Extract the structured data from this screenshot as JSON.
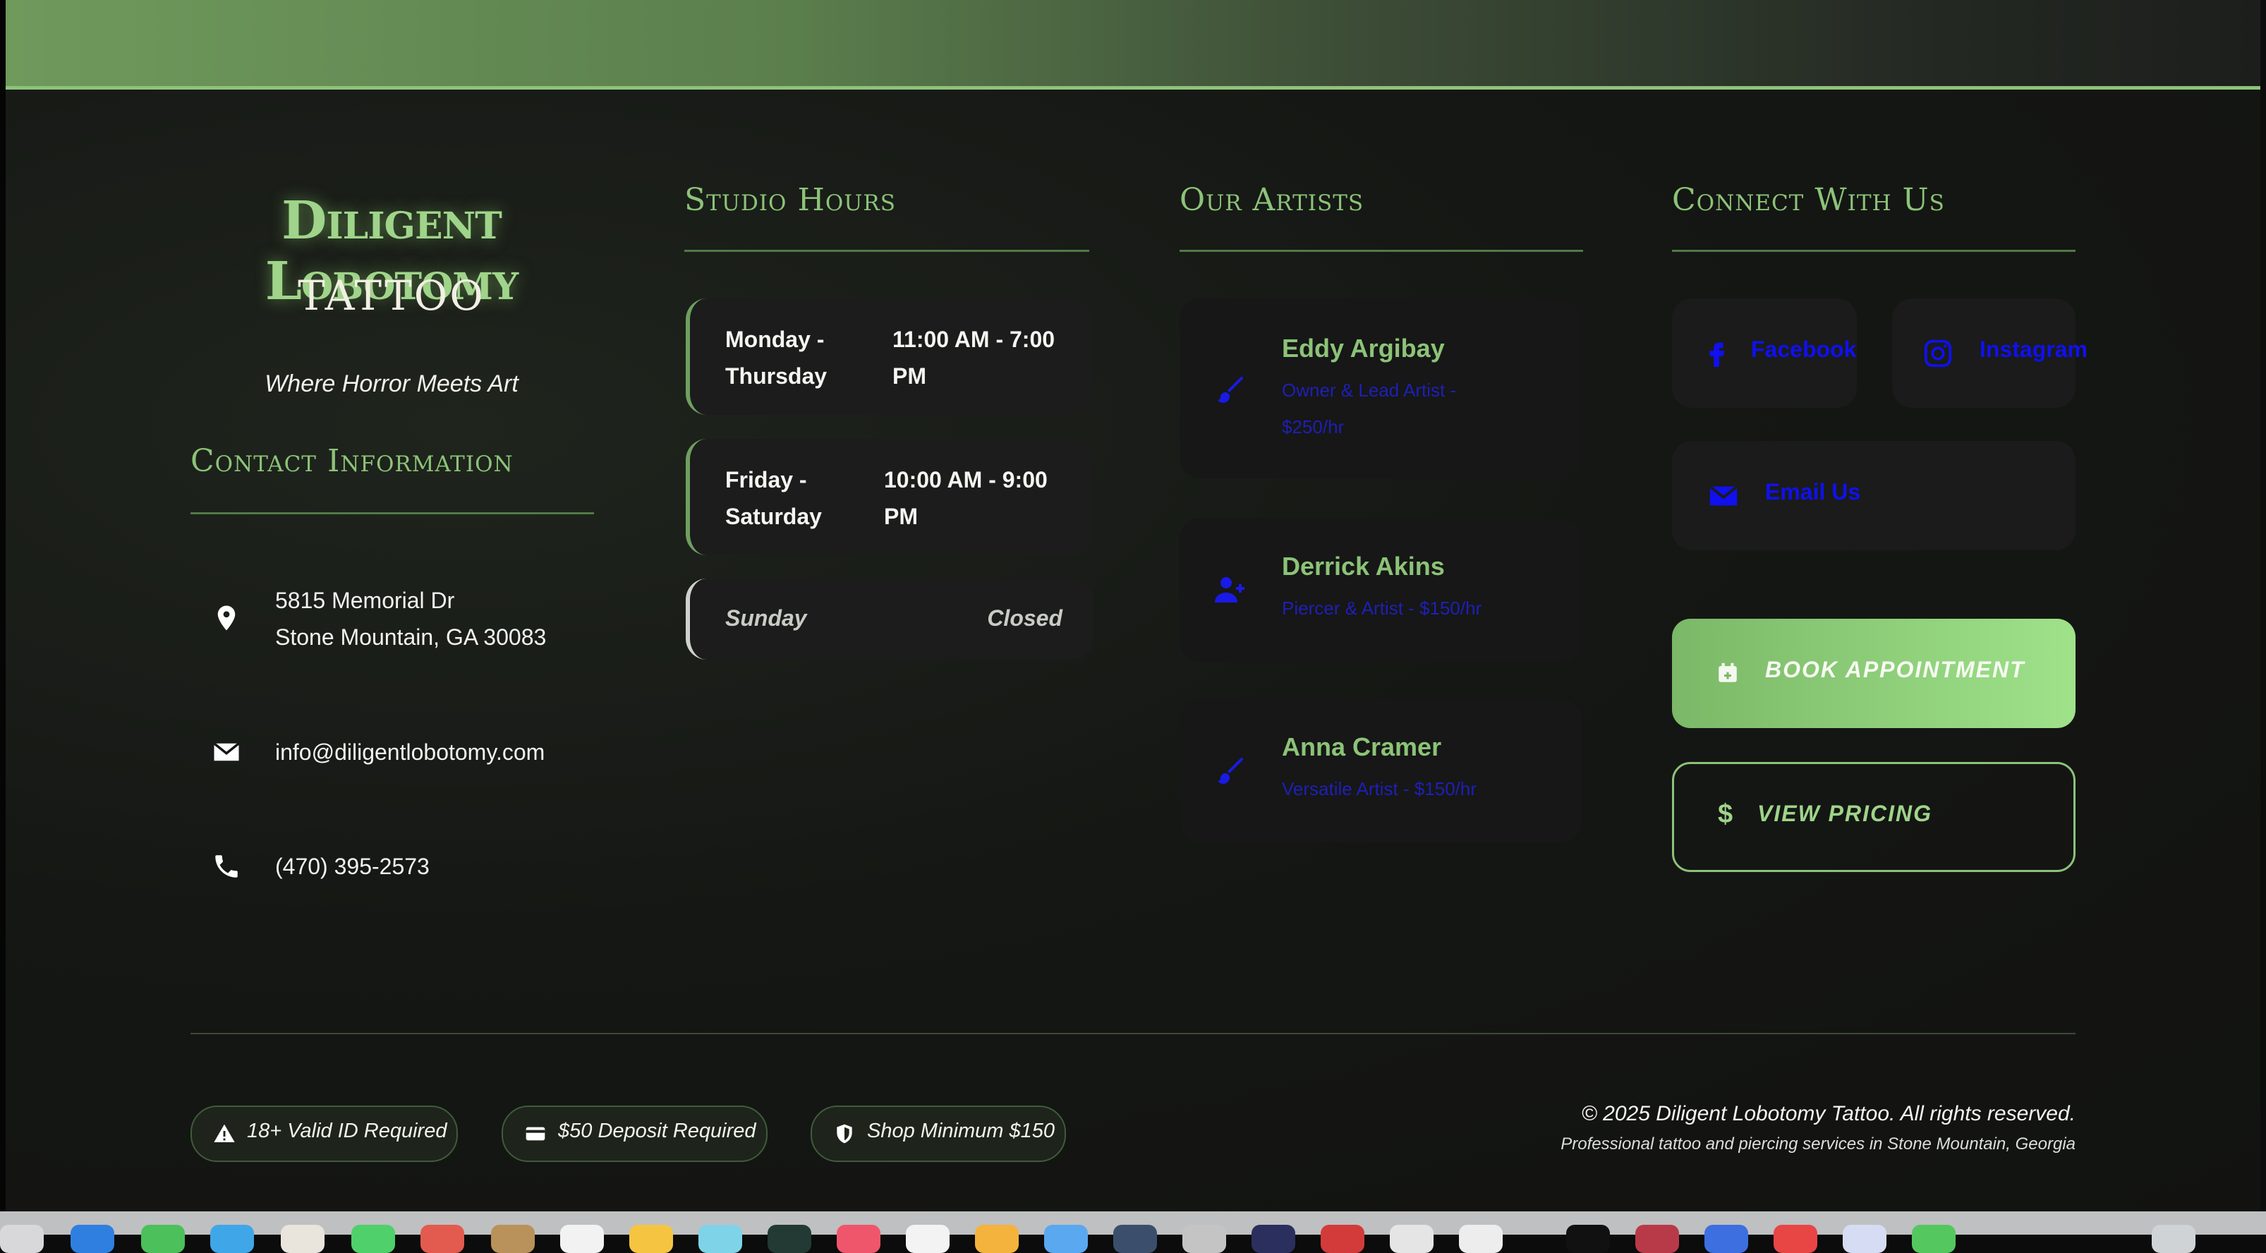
{
  "brand": {
    "title": "Diligent Lobotomy",
    "subtitle": "TATTOO",
    "tagline": "Where Horror Meets Art"
  },
  "contact": {
    "heading": "Contact Information",
    "address_line1": "5815 Memorial Dr",
    "address_line2": "Stone Mountain, GA 30083",
    "email": "info@diligentlobotomy.com",
    "phone": "(470) 395-2573"
  },
  "hours": {
    "heading": "Studio Hours",
    "rows": [
      {
        "day1": "Monday -",
        "day2": "Thursday",
        "time1": "11:00 AM - 7:00",
        "time2": "PM"
      },
      {
        "day1": "Friday -",
        "day2": "Saturday",
        "time1": "10:00 AM - 9:00",
        "time2": "PM"
      },
      {
        "day1": "Sunday",
        "time1": "Closed"
      }
    ]
  },
  "artists": {
    "heading": "Our Artists",
    "items": [
      {
        "name": "Eddy Argibay",
        "role": "Owner & Lead Artist - $250/hr",
        "icon": "brush-icon"
      },
      {
        "name": "Derrick Akins",
        "role": "Piercer & Artist - $150/hr",
        "icon": "user-plus-icon"
      },
      {
        "name": "Anna Cramer",
        "role": "Versatile Artist - $150/hr",
        "icon": "brush-icon"
      }
    ]
  },
  "connect": {
    "heading": "Connect With Us",
    "facebook": "Facebook",
    "instagram": "Instagram",
    "email": "Email Us",
    "book": "BOOK APPOINTMENT",
    "pricing": "VIEW PRICING"
  },
  "badges": [
    "18+ Valid ID Required",
    "$50 Deposit Required",
    "Shop Minimum $150"
  ],
  "footer": {
    "copyright": "© 2025 Diligent Lobotomy Tattoo. All rights reserved.",
    "sub": "Professional tattoo and piercing services in Stone Mountain, Georgia"
  },
  "colors": {
    "accent": "#8cc378",
    "link": "#1010f0",
    "card": "#1b1c1b",
    "background": "#121311"
  }
}
